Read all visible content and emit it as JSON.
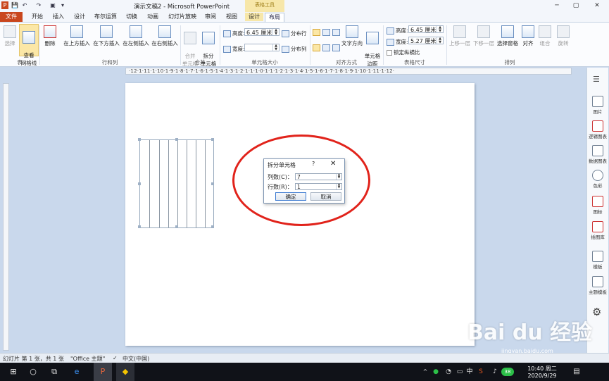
{
  "titlebar": {
    "title": "演示文稿2 - Microsoft PowerPoint",
    "context_tools": "表格工具",
    "quick_access": [
      "P",
      "💾",
      "↶",
      "↷",
      "▣",
      "▾"
    ],
    "win_min": "─",
    "win_max": "▢",
    "win_close": "✕"
  },
  "tabs": {
    "file": "文件",
    "home": "开始",
    "insert": "插入",
    "design": "设计",
    "boolean": "布尔运算",
    "transitions": "切换",
    "animations": "动画",
    "slideshow": "幻灯片放映",
    "review": "审阅",
    "view": "视图",
    "table_design": "设计",
    "table_layout": "布局"
  },
  "ribbon": {
    "select": "选择",
    "view_grid": "查看\n网格线",
    "delete": "删除",
    "insert_above": "在上方插入",
    "insert_below": "在下方插入",
    "insert_left": "在左侧插入",
    "insert_right": "在右侧插入",
    "merge_cells": "合并\n单元格",
    "split_cells": "拆分\n单元格",
    "height_label": "高度:",
    "height_value": "6.45 厘米",
    "width_label": "宽度:",
    "width_value": "",
    "distribute_rows": "分布行",
    "distribute_cols": "分布列",
    "text_direction": "文字方向",
    "cell_margins": "单元格\n边距",
    "tbl_height_label": "高度:",
    "tbl_height_value": "6.45 厘米",
    "tbl_width_label": "宽度:",
    "tbl_width_value": "5.27 厘米",
    "lock_ratio": "锁定纵横比",
    "bring_forward": "上移一层",
    "send_backward": "下移一层",
    "selection_pane": "选择窗格",
    "align": "对齐",
    "group": "组合",
    "rotate": "旋转",
    "groups": {
      "table": "表",
      "rows_cols": "行和列",
      "merge": "合并",
      "cell_size": "单元格大小",
      "alignment": "对齐方式",
      "table_size": "表格尺寸",
      "arrange": "排列"
    }
  },
  "ruler_h": "·12·1·11·1·10·1·9·1·8·1·7·1·6·1·5·1·4·1·3·1·2·1·1·1·0·1·1·1·2·1·3·1·4·1·5·1·6·1·7·1·8·1·9·1·10·1·11·1·12·",
  "dialog": {
    "title": "拆分单元格",
    "help": "?",
    "close": "✕",
    "cols_label": "列数(C)：",
    "cols_value": "7",
    "rows_label": "行数(R)：",
    "rows_value": "1",
    "ok": "确定",
    "cancel": "取消"
  },
  "right_pane": [
    "图片",
    "逻辑图表",
    "数据图表",
    "色彩",
    "图标",
    "插图库",
    "模板",
    "主题模板"
  ],
  "status": {
    "slide_info": "幻灯片 第 1 张，共 1 张",
    "theme": "\"Office 主题\"",
    "lang": "中文(中国)"
  },
  "taskbar": {
    "time": "10:40 周二",
    "date": "2020/9/29",
    "ime": "中",
    "tray_badge": "38"
  },
  "watermark": {
    "main": "Bai du 经验",
    "sub": "jingyan.baidu.com"
  },
  "colors": {
    "accent": "#c9461d",
    "circle": "#e1231b",
    "context": "#f7e7a9"
  }
}
